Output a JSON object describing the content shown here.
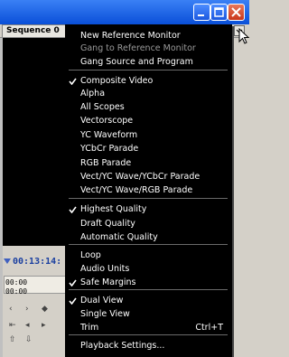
{
  "window": {
    "buttons": [
      "minimize",
      "maximize",
      "close"
    ]
  },
  "panel": {
    "tab_label": "Sequence 0",
    "timecode": "00:13:14:",
    "ruler_label_top": "00:00",
    "ruler_label_bottom": "00:00"
  },
  "menu": {
    "items": [
      {
        "label": "New Reference Monitor",
        "checked": false,
        "disabled": false
      },
      {
        "label": "Gang to Reference Monitor",
        "checked": false,
        "disabled": true
      },
      {
        "label": "Gang Source and Program",
        "checked": false,
        "disabled": false
      },
      {
        "label": "Composite Video",
        "checked": true,
        "disabled": false
      },
      {
        "label": "Alpha",
        "checked": false,
        "disabled": false
      },
      {
        "label": "All Scopes",
        "checked": false,
        "disabled": false
      },
      {
        "label": "Vectorscope",
        "checked": false,
        "disabled": false
      },
      {
        "label": "YC Waveform",
        "checked": false,
        "disabled": false
      },
      {
        "label": "YCbCr Parade",
        "checked": false,
        "disabled": false
      },
      {
        "label": "RGB Parade",
        "checked": false,
        "disabled": false
      },
      {
        "label": "Vect/YC Wave/YCbCr Parade",
        "checked": false,
        "disabled": false
      },
      {
        "label": "Vect/YC Wave/RGB Parade",
        "checked": false,
        "disabled": false
      },
      {
        "label": "Highest Quality",
        "checked": true,
        "disabled": false
      },
      {
        "label": "Draft Quality",
        "checked": false,
        "disabled": false
      },
      {
        "label": "Automatic Quality",
        "checked": false,
        "disabled": false
      },
      {
        "label": "Loop",
        "checked": false,
        "disabled": false
      },
      {
        "label": "Audio Units",
        "checked": false,
        "disabled": false
      },
      {
        "label": "Safe Margins",
        "checked": true,
        "disabled": false
      },
      {
        "label": "Dual View",
        "checked": true,
        "disabled": false
      },
      {
        "label": "Single View",
        "checked": false,
        "disabled": false
      },
      {
        "label": "Trim",
        "checked": false,
        "disabled": false,
        "shortcut": "Ctrl+T"
      },
      {
        "label": "Playback Settings...",
        "checked": false,
        "disabled": false
      }
    ]
  }
}
